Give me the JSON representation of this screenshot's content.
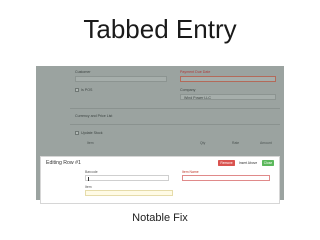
{
  "slide": {
    "title": "Tabbed Entry",
    "caption": "Notable Fix"
  },
  "form": {
    "customer_label": "Customer",
    "payment_due_label": "Payment Due Date",
    "is_pos_label": "Is POS",
    "company_label": "Company",
    "company_value": "Wind Power LLC",
    "section_label": "Currency and Price List",
    "update_stock_label": "Update Stock"
  },
  "items_table": {
    "columns": [
      "Item",
      "Qty",
      "Rate",
      "Amount"
    ]
  },
  "edit_panel": {
    "title": "Editing Row #1",
    "buttons": {
      "remove": "Remove",
      "insert": "Insert Above",
      "close": "Close"
    },
    "barcode_label": "Barcode",
    "barcode_value": "|",
    "item_name_label": "Item Name",
    "item_label": "Item"
  }
}
